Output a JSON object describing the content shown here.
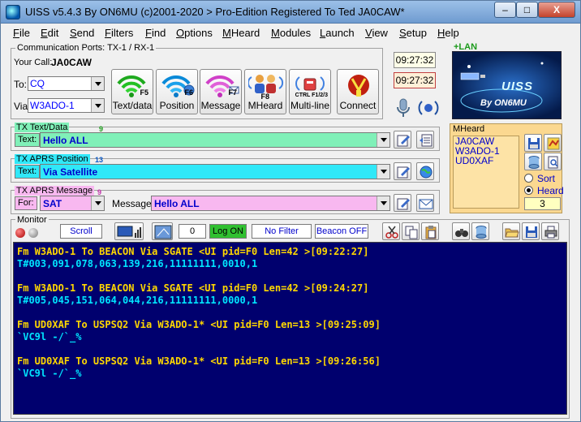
{
  "window": {
    "title": "UISS v5.4.3 By ON6MU (c)2001-2020 > Pro-Edition Registered To Ted JA0CAW*"
  },
  "window_controls": {
    "minimize": "–",
    "maximize": "□",
    "close": "X"
  },
  "menu": [
    {
      "label": "File",
      "u": "F",
      "rest": "ile"
    },
    {
      "label": "Edit",
      "u": "E",
      "rest": "dit"
    },
    {
      "label": "Send",
      "u": "S",
      "rest": "end"
    },
    {
      "label": "Filters",
      "u": "F",
      "rest": "ilters"
    },
    {
      "label": "Find",
      "u": "F",
      "rest": "ind"
    },
    {
      "label": "Options",
      "u": "O",
      "rest": "ptions"
    },
    {
      "label": "MHeard",
      "u": "M",
      "rest": "Heard"
    },
    {
      "label": "Modules",
      "u": "M",
      "rest": "odules"
    },
    {
      "label": "Launch",
      "u": "L",
      "rest": "aunch"
    },
    {
      "label": "View",
      "u": "V",
      "rest": "iew"
    },
    {
      "label": "Setup",
      "u": "S",
      "rest": "etup"
    },
    {
      "label": "Help",
      "u": "H",
      "rest": "elp"
    }
  ],
  "comm": {
    "label": "Communication Ports: TX-1 / RX-1",
    "your_call_label": "Your Call:",
    "your_call": "JA0CAW",
    "to_label": "To:",
    "to_value": "CQ",
    "via_label": "Via:",
    "via_value": "W3ADO-1"
  },
  "buttons": {
    "text_data": {
      "label": "Text/data",
      "fkey": "F5"
    },
    "position": {
      "label": "Position",
      "fkey": "F6"
    },
    "message": {
      "label": "Message",
      "fkey": "F7"
    },
    "mheard": {
      "label": "MHeard",
      "fkey": "F8"
    },
    "multiline": {
      "label": "Multi-line",
      "fkey": "CTRL F1/2/3"
    },
    "connect": {
      "label": "Connect"
    }
  },
  "clocks": {
    "local": "09:27:32",
    "utc": "09:27:32"
  },
  "lan_label": "+LAN",
  "logo": {
    "main": "UISS",
    "by": "By ON6MU"
  },
  "tx_text": {
    "label": "TX Text/Data",
    "badge": "9",
    "field_label": "Text:",
    "value": "Hello ALL"
  },
  "tx_aprs_pos": {
    "label": "TX APRS Position",
    "badge": "13",
    "field_label": "Text:",
    "value": "Via Satellite"
  },
  "tx_aprs_msg": {
    "label": "TX APRS Message",
    "badge": "9",
    "for_label": "For:",
    "for_value": "SAT",
    "message_label": "Message:",
    "message_value": "Hello ALL"
  },
  "mheard": {
    "label": "MHeard",
    "items": [
      "JA0CAW",
      "W3ADO-1",
      "UD0XAF"
    ],
    "sort_label": "Sort",
    "heard_label": "Heard",
    "count": "3"
  },
  "monitor": {
    "label": "Monitor",
    "scroll": "Scroll",
    "counter": "0",
    "log_on": "Log ON",
    "no_filter": "No Filter",
    "beacon_off": "Beacon OFF",
    "lines": [
      {
        "kind": "hdr",
        "text": "Fm W3ADO-1 To BEACON Via SGATE <UI pid=F0 Len=42 >[09:22:27]"
      },
      {
        "kind": "body",
        "text": "T#003,091,078,063,139,216,11111111,0010,1"
      },
      {
        "kind": "hdr",
        "text": "Fm W3ADO-1 To BEACON Via SGATE <UI pid=F0 Len=42 >[09:24:27]"
      },
      {
        "kind": "body",
        "text": "T#005,045,151,064,044,216,11111111,0000,1"
      },
      {
        "kind": "hdr",
        "text": "Fm UD0XAF To USPSQ2 Via W3ADO-1* <UI pid=F0 Len=13 >[09:25:09]"
      },
      {
        "kind": "body",
        "text": "`VC9l -/`_%"
      },
      {
        "kind": "hdr",
        "text": "Fm UD0XAF To USPSQ2 Via W3ADO-1* <UI pid=F0 Len=13 >[09:26:56]"
      },
      {
        "kind": "body",
        "text": "`VC9l -/`_%"
      }
    ]
  },
  "colors": {
    "tx_text_bg": "#80f0b8",
    "tx_pos_bg": "#30e8f8",
    "tx_msg_bg": "#f8b8f0",
    "monitor_bg": "#00006e",
    "monitor_hdr": "#ffd700",
    "monitor_body": "#00e5ff"
  }
}
